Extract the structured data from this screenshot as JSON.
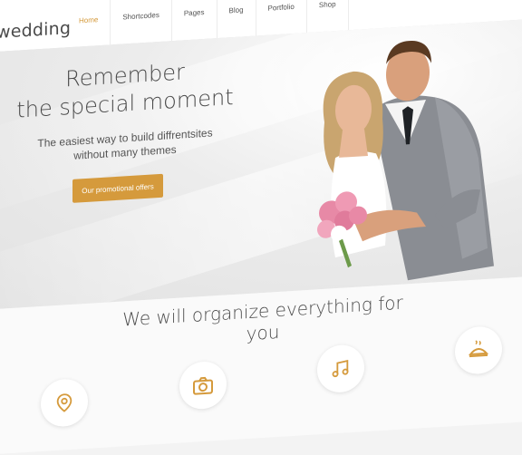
{
  "brand": {
    "logo": "wedding",
    "accent_color": "#d59a3c"
  },
  "nav": {
    "items": [
      {
        "label": "Home",
        "active": true
      },
      {
        "label": "Shortcodes",
        "active": false
      },
      {
        "label": "Pages",
        "active": false
      },
      {
        "label": "Blog",
        "active": false
      },
      {
        "label": "Portfolio",
        "active": false
      },
      {
        "label": "Shop",
        "active": false
      }
    ]
  },
  "hero": {
    "title_line1": "Remember",
    "title_line2": "the special moment",
    "subtitle_line1": "The easiest way to build diffrentsites",
    "subtitle_line2": "without many themes",
    "button_label": "Our promotional offers"
  },
  "section": {
    "title": "We will organize everything for you",
    "features": [
      {
        "icon": "location-pin-icon"
      },
      {
        "icon": "camera-icon"
      },
      {
        "icon": "music-note-icon"
      },
      {
        "icon": "dish-icon"
      }
    ]
  }
}
